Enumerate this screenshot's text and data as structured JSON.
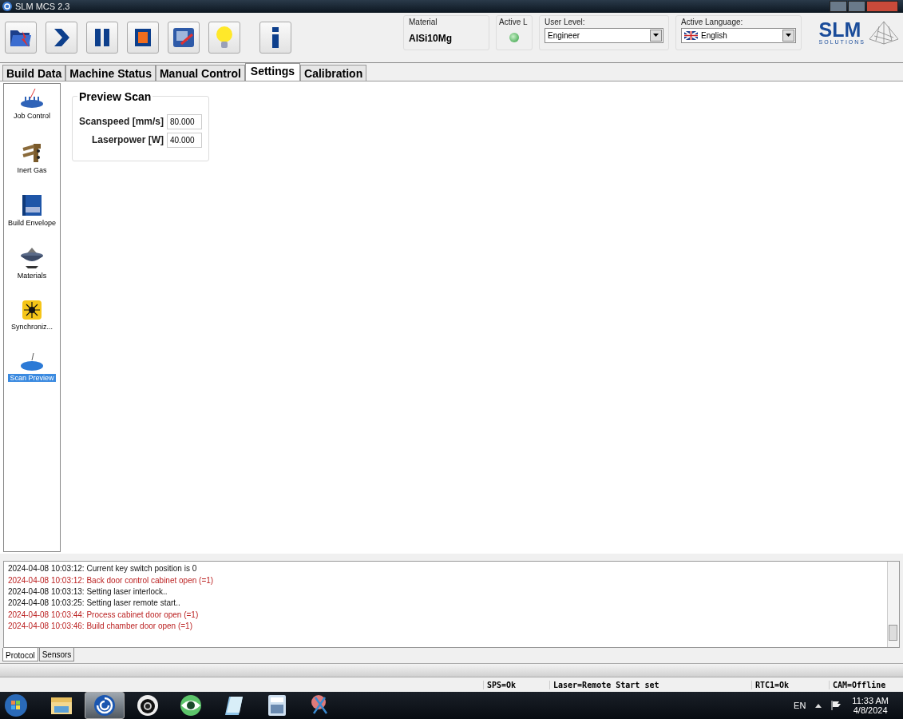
{
  "window": {
    "title": "SLM MCS 2.3"
  },
  "toolbar": [
    {
      "kind": "open"
    },
    {
      "kind": "start"
    },
    {
      "kind": "pause"
    },
    {
      "kind": "stop"
    },
    {
      "kind": "screen"
    },
    {
      "kind": "light"
    },
    {
      "kind": "info"
    }
  ],
  "material": {
    "label": "Material",
    "value": "AlSi10Mg"
  },
  "active_laser": {
    "label": "Active L",
    "on": true
  },
  "user_level": {
    "label": "User Level:",
    "value": "Engineer"
  },
  "language": {
    "label": "Active Language:",
    "value": "English"
  },
  "logo": {
    "name": "SLM",
    "sub": "SOLUTIONS"
  },
  "tabs": [
    {
      "label": "Build Data",
      "selected": false
    },
    {
      "label": "Machine Status",
      "selected": false
    },
    {
      "label": "Manual Control",
      "selected": false
    },
    {
      "label": "Settings",
      "selected": true
    },
    {
      "label": "Calibration",
      "selected": false
    }
  ],
  "sidebar": [
    {
      "label": "Job Control",
      "kind": "job",
      "selected": false
    },
    {
      "label": "Inert Gas",
      "kind": "gas",
      "selected": false
    },
    {
      "label": "Build Envelope",
      "kind": "envelope",
      "selected": false
    },
    {
      "label": "Materials",
      "kind": "materials",
      "selected": false
    },
    {
      "label": "Synchroniz...",
      "kind": "sync",
      "selected": false
    },
    {
      "label": "Scan Preview",
      "kind": "scan",
      "selected": true
    }
  ],
  "preview_scan": {
    "title": "Preview Scan",
    "fields": [
      {
        "label": "Scanspeed [mm/s]",
        "value": "80.000"
      },
      {
        "label": "Laserpower [W]",
        "value": "40.000"
      }
    ]
  },
  "log": [
    {
      "text": "2024-04-08 10:03:12: Current key switch position is 0",
      "kind": "info"
    },
    {
      "text": "2024-04-08 10:03:12: Back door control cabinet open (=1)",
      "kind": "error"
    },
    {
      "text": "2024-04-08 10:03:13: Setting laser interlock..",
      "kind": "info"
    },
    {
      "text": "2024-04-08 10:03:25: Setting laser remote start..",
      "kind": "info"
    },
    {
      "text": "2024-04-08 10:03:44: Process cabinet door open (=1)",
      "kind": "error"
    },
    {
      "text": "2024-04-08 10:03:46: Build chamber door open (=1)",
      "kind": "error"
    }
  ],
  "bottom_tabs": [
    {
      "label": "Protocol",
      "selected": true
    },
    {
      "label": "Sensors",
      "selected": false
    }
  ],
  "status_bar": [
    "SPS=Ok",
    "Laser=Remote Start set",
    "RTC1=Ok",
    "CAM=Offline"
  ],
  "taskbar": {
    "apps": [
      {
        "kind": "folder",
        "selected": false
      },
      {
        "kind": "slm",
        "selected": true
      },
      {
        "kind": "camera",
        "selected": false
      },
      {
        "kind": "eye",
        "selected": false
      },
      {
        "kind": "notepad",
        "selected": false
      },
      {
        "kind": "calculator",
        "selected": false
      },
      {
        "kind": "snipping",
        "selected": false
      }
    ],
    "language": "EN",
    "time": "11:33 AM",
    "date": "4/8/2024"
  }
}
